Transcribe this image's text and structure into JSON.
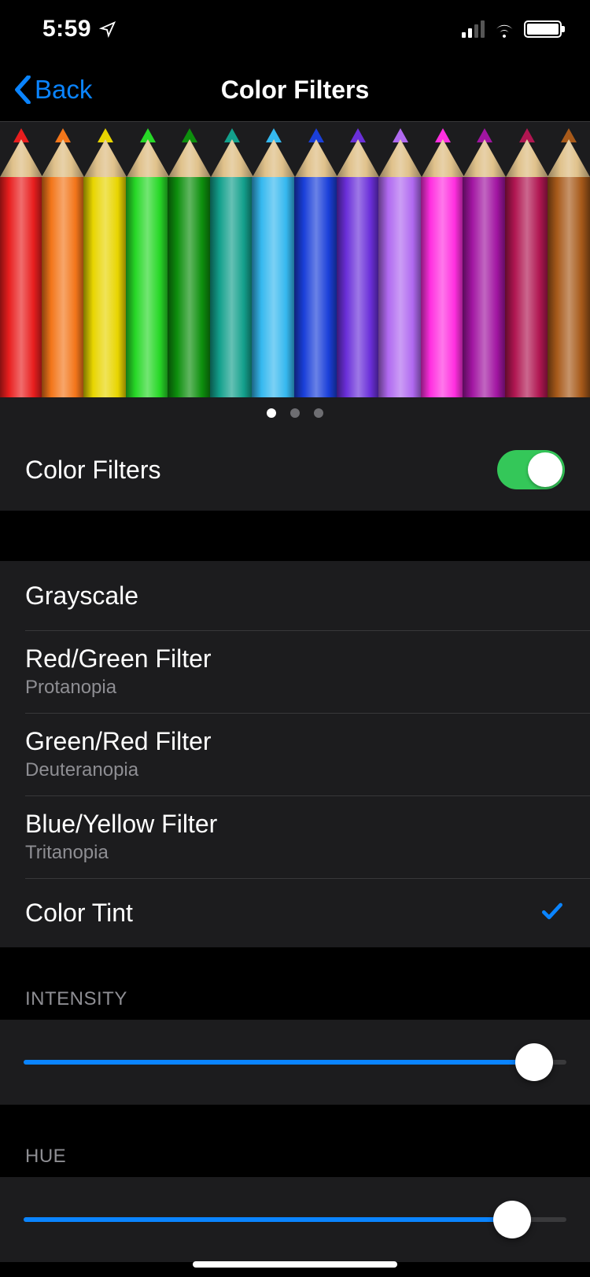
{
  "status": {
    "time": "5:59"
  },
  "nav": {
    "back": "Back",
    "title": "Color Filters"
  },
  "pencils": [
    "#e81e1e",
    "#f3761a",
    "#e8d500",
    "#27d827",
    "#0d8f0d",
    "#13a08c",
    "#35b8ef",
    "#1a3fd9",
    "#6a2fd9",
    "#b069f0",
    "#ff2fe0",
    "#a115a1",
    "#b01651",
    "#a85a1a"
  ],
  "page_dots": {
    "count": 3,
    "active": 0
  },
  "toggle": {
    "label": "Color Filters",
    "on": true
  },
  "filter_options": [
    {
      "title": "Grayscale",
      "sub": "",
      "selected": false
    },
    {
      "title": "Red/Green Filter",
      "sub": "Protanopia",
      "selected": false
    },
    {
      "title": "Green/Red Filter",
      "sub": "Deuteranopia",
      "selected": false
    },
    {
      "title": "Blue/Yellow Filter",
      "sub": "Tritanopia",
      "selected": false
    },
    {
      "title": "Color Tint",
      "sub": "",
      "selected": true
    }
  ],
  "sliders": {
    "intensity": {
      "label": "INTENSITY",
      "pct": 94
    },
    "hue": {
      "label": "HUE",
      "pct": 90
    }
  },
  "colors": {
    "accent": "#0a84ff",
    "toggle_on": "#34c759"
  }
}
